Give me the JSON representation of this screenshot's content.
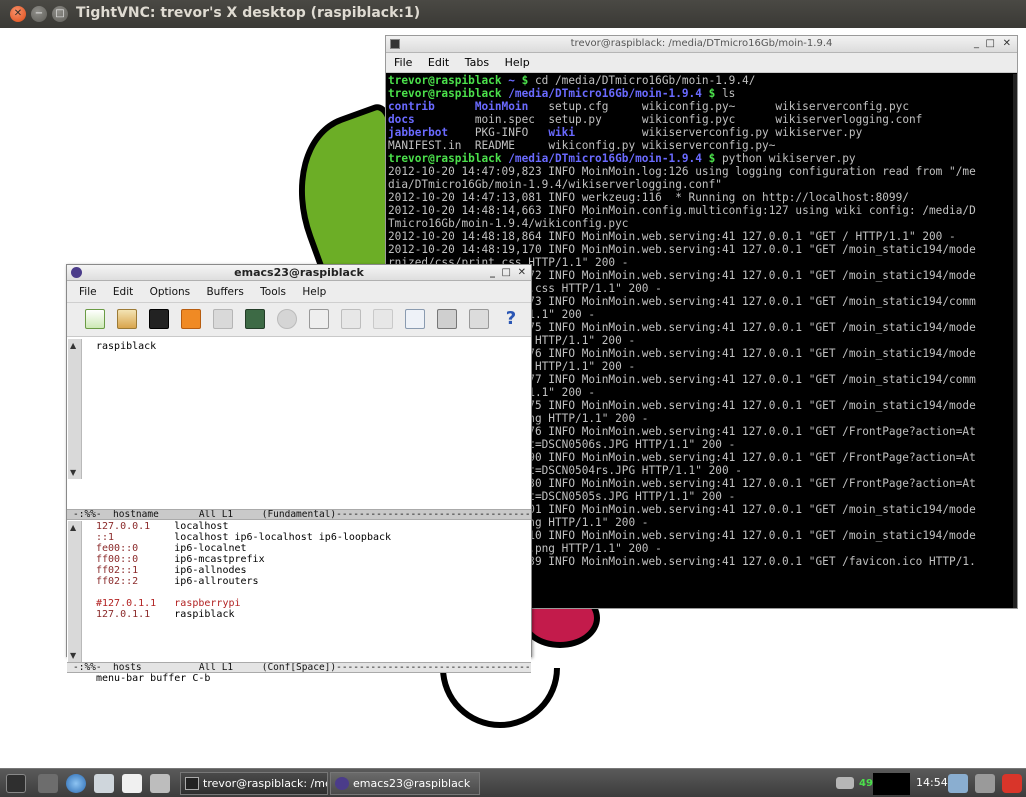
{
  "vnc_window": {
    "title": "TightVNC: trevor's X desktop (raspiblack:1)",
    "close_glyph": "✕",
    "min_glyph": "−",
    "max_glyph": "□"
  },
  "terminal": {
    "title": "trevor@raspiblack: /media/DTmicro16Gb/moin-1.9.4",
    "controls": [
      "_",
      "□",
      "✕"
    ],
    "menu": [
      "File",
      "Edit",
      "Tabs",
      "Help"
    ],
    "lines": [
      {
        "prompt_user": "trevor@raspiblack",
        "prompt_path": " ~ ",
        "prompt_sym": "$",
        "text": " cd /media/DTmicro16Gb/moin-1.9.4/"
      },
      {
        "prompt_user": "trevor@raspiblack",
        "prompt_path": " /media/DTmicro16Gb/moin-1.9.4 ",
        "prompt_sym": "$",
        "text": " ls"
      },
      {
        "ls": [
          [
            "contrib",
            true
          ],
          [
            "MoinMoin",
            true
          ],
          [
            "setup.cfg",
            false
          ],
          [
            "wikiconfig.py~",
            false
          ],
          [
            "wikiserverconfig.pyc",
            false
          ]
        ]
      },
      {
        "ls": [
          [
            "docs",
            true
          ],
          [
            "moin.spec",
            false
          ],
          [
            "setup.py",
            false
          ],
          [
            "wikiconfig.pyc",
            false
          ],
          [
            "wikiserverlogging.conf",
            false
          ]
        ]
      },
      {
        "ls": [
          [
            "jabberbot",
            true
          ],
          [
            "PKG-INFO",
            false
          ],
          [
            "wiki",
            true
          ],
          [
            "wikiserverconfig.py",
            false
          ],
          [
            "wikiserver.py",
            false
          ]
        ]
      },
      {
        "ls": [
          [
            "MANIFEST.in",
            false
          ],
          [
            "README",
            false
          ],
          [
            "wikiconfig.py",
            false
          ],
          [
            "wikiserverconfig.py~",
            false
          ],
          [
            "",
            false
          ]
        ]
      },
      {
        "prompt_user": "trevor@raspiblack",
        "prompt_path": " /media/DTmicro16Gb/moin-1.9.4 ",
        "prompt_sym": "$",
        "text": " python wikiserver.py"
      },
      {
        "text": "2012-10-20 14:47:09,823 INFO MoinMoin.log:126 using logging configuration read from \"/me"
      },
      {
        "text": "dia/DTmicro16Gb/moin-1.9.4/wikiserverlogging.conf\""
      },
      {
        "text": "2012-10-20 14:47:13,081 INFO werkzeug:116  * Running on http://localhost:8099/"
      },
      {
        "text": "2012-10-20 14:48:14,663 INFO MoinMoin.config.multiconfig:127 using wiki config: /media/D"
      },
      {
        "text": "Tmicro16Gb/moin-1.9.4/wikiconfig.pyc"
      },
      {
        "text": "2012-10-20 14:48:18,864 INFO MoinMoin.web.serving:41 127.0.0.1 \"GET / HTTP/1.1\" 200 -"
      },
      {
        "text": "2012-10-20 14:48:19,170 INFO MoinMoin.web.serving:41 127.0.0.1 \"GET /moin_static194/mode"
      },
      {
        "text": "rnized/css/print.css HTTP/1.1\" 200 -"
      },
      {
        "text": "2012-10-20 14:48:19,172 INFO MoinMoin.web.serving:41 127.0.0.1 \"GET /moin_static194/mode"
      },
      {
        "text": "rnized/css/projection.css HTTP/1.1\" 200 -"
      },
      {
        "text": "2012-10-20 14:48:19,173 INFO MoinMoin.web.serving:41 127.0.0.1 \"GET /moin_static194/comm"
      },
      {
        "text": "on/js/common.js HTTP/1.1\" 200 -"
      },
      {
        "text": "2012-10-20 14:48:19,175 INFO MoinMoin.web.serving:41 127.0.0.1 \"GET /moin_static194/mode"
      },
      {
        "text": "rnized/css/common.css HTTP/1.1\" 200 -"
      },
      {
        "text": "2012-10-20 14:48:19,176 INFO MoinMoin.web.serving:41 127.0.0.1 \"GET /moin_static194/mode"
      },
      {
        "text": "rnized/css/screen.css HTTP/1.1\" 200 -"
      },
      {
        "text": "2012-10-20 14:48:19,177 INFO MoinMoin.web.serving:41 127.0.0.1 \"GET /moin_static194/comm"
      },
      {
        "text": "on/moinmoin.png HTTP/1.1\" 200 -"
      },
      {
        "text": "2012-10-20 14:48:19,675 INFO MoinMoin.web.serving:41 127.0.0.1 \"GET /moin_static194/mode"
      },
      {
        "text": "rnized/img/moin-www.png HTTP/1.1\" 200 -"
      },
      {
        "text": "2012-10-20 14:48:20,176 INFO MoinMoin.web.serving:41 127.0.0.1 \"GET /FrontPage?action=At"
      },
      {
        "text": "tachFile&do=get&target=DSCN0506s.JPG HTTP/1.1\" 200 -"
      },
      {
        "text": "2012-10-20 14:48:20,190 INFO MoinMoin.web.serving:41 127.0.0.1 \"GET /FrontPage?action=At"
      },
      {
        "text": "tachFile&do=get&target=DSCN0504rs.JPG HTTP/1.1\" 200 -"
      },
      {
        "text": "2012-10-20 14:48:20,730 INFO MoinMoin.web.serving:41 127.0.0.1 \"GET /FrontPage?action=At"
      },
      {
        "text": "tachFile&do=get&target=DSCN0505s.JPG HTTP/1.1\" 200 -"
      },
      {
        "text": "2012-10-20 14:48:21,001 INFO MoinMoin.web.serving:41 127.0.0.1 \"GET /moin_static194/mode"
      },
      {
        "text": "rnized/img/moin-rss.png HTTP/1.1\" 200 -"
      },
      {
        "text": "2012-10-20 14:48:21,010 INFO MoinMoin.web.serving:41 127.0.0.1 \"GET /moin_static194/mode"
      },
      {
        "text": "rnized/img/moin-inter.png HTTP/1.1\" 200 -"
      },
      {
        "text": "2012-10-20 14:48:21,139 INFO MoinMoin.web.serving:41 127.0.0.1 \"GET /favicon.ico HTTP/1."
      }
    ]
  },
  "emacs": {
    "title": "emacs23@raspiblack",
    "controls": [
      "_",
      "□",
      "✕"
    ],
    "menu": [
      "File",
      "Edit",
      "Options",
      "Buffers",
      "Tools",
      "Help"
    ],
    "buffer1_text": "raspiblack",
    "modeline1": "-:%%-  hostname       All L1     (Fundamental)-----------------------------------------------",
    "hosts": [
      {
        "ip": "127.0.0.1",
        "names": "localhost",
        "comment": false
      },
      {
        "ip": "::1",
        "names": "localhost ip6-localhost ip6-loopback",
        "comment": false
      },
      {
        "ip": "fe00::0",
        "names": "ip6-localnet",
        "comment": false
      },
      {
        "ip": "ff00::0",
        "names": "ip6-mcastprefix",
        "comment": false
      },
      {
        "ip": "ff02::1",
        "names": "ip6-allnodes",
        "comment": false
      },
      {
        "ip": "ff02::2",
        "names": "ip6-allrouters",
        "comment": false
      },
      {
        "ip": "",
        "names": "",
        "comment": false
      },
      {
        "ip": "#127.0.1.1",
        "names": "raspberrypi",
        "comment": true
      },
      {
        "ip": "127.0.1.1",
        "names": "raspiblack",
        "comment": false
      }
    ],
    "modeline2": "-:%%-  hosts          All L1     (Conf[Space])-----------------------------------------------",
    "echo_area": "menu-bar buffer C-b"
  },
  "taskbar": {
    "tasks": [
      {
        "label": "trevor@raspiblack: /me..."
      },
      {
        "label": "emacs23@raspiblack"
      }
    ],
    "tray_number": "49",
    "clock": "14:54"
  },
  "colors": {
    "leaf_green": "#6cae26",
    "berry_red": "#c31b4b",
    "prompt_green": "#4be04b",
    "dir_blue": "#6a6aff"
  }
}
